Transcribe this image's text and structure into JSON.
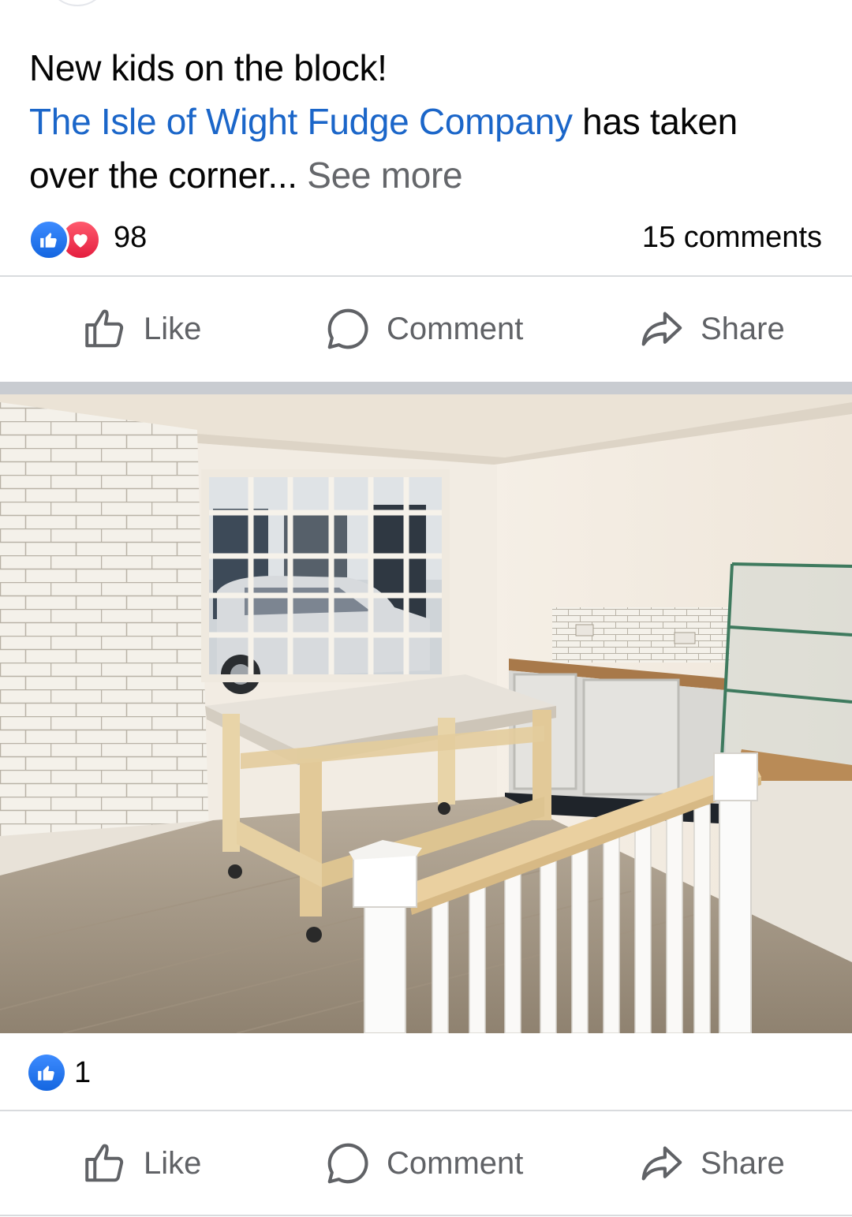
{
  "post": {
    "line1": "New kids on the block!",
    "page_link": "The Isle of Wight Fudge Company",
    "line2_rest": " has taken",
    "line3": "over the corner...",
    "see_more": " See more"
  },
  "reactions": {
    "count": "98",
    "comments": "15 comments",
    "icons": [
      "like-icon",
      "love-icon"
    ]
  },
  "actions": {
    "like": "Like",
    "comment": "Comment",
    "share": "Share"
  },
  "photo": {
    "reaction_count": "1",
    "actions": {
      "like": "Like",
      "comment": "Comment",
      "share": "Share"
    }
  },
  "colors": {
    "link": "#1b66c9",
    "like_blue": "#1877f2",
    "love_red": "#e41e3f",
    "action_gray": "#606266"
  }
}
